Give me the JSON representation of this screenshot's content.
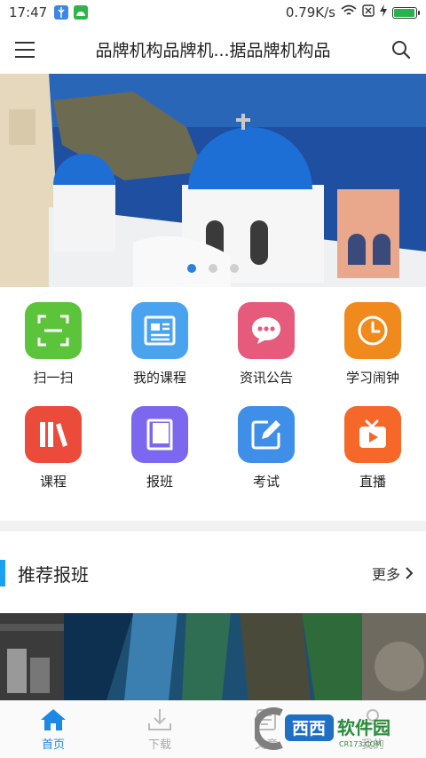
{
  "status_bar": {
    "time": "17:47",
    "network_speed": "0.79K/s",
    "icons": [
      "usb-icon",
      "android-icon",
      "wifi-icon",
      "sim-off-icon",
      "charging-icon",
      "battery-icon"
    ],
    "battery_level": 0.95
  },
  "header": {
    "title": "品牌机构品牌机...据品牌机构品",
    "menu_icon": "hamburger-menu-icon",
    "search_icon": "search-icon"
  },
  "banner": {
    "slide_count": 3,
    "active_slide": 1
  },
  "features": [
    {
      "label": "扫一扫",
      "icon": "scan-icon",
      "color": "#5cc43b"
    },
    {
      "label": "我的课程",
      "icon": "course-card-icon",
      "color": "#4aa3ee"
    },
    {
      "label": "资讯公告",
      "icon": "chat-bubble-icon",
      "color": "#e65a7c"
    },
    {
      "label": "学习闹钟",
      "icon": "clock-icon",
      "color": "#f08a1c"
    },
    {
      "label": "课程",
      "icon": "books-icon",
      "color": "#eb4b3b"
    },
    {
      "label": "报班",
      "icon": "notebook-icon",
      "color": "#7b68ee"
    },
    {
      "label": "考试",
      "icon": "edit-icon",
      "color": "#3f8fe8"
    },
    {
      "label": "直播",
      "icon": "tv-play-icon",
      "color": "#f5682a"
    }
  ],
  "section": {
    "title": "推荐报班",
    "more_label": "更多"
  },
  "bottom_nav": {
    "items": [
      {
        "label": "首页",
        "icon": "home-icon",
        "active": true
      },
      {
        "label": "下载",
        "icon": "download-icon",
        "active": false
      },
      {
        "label": "文章",
        "icon": "article-icon",
        "active": false
      },
      {
        "label": "我的",
        "icon": "profile-icon",
        "active": false
      }
    ]
  },
  "watermark": {
    "brand": "西西",
    "text": "软件园",
    "domain": "CR173.COM"
  }
}
